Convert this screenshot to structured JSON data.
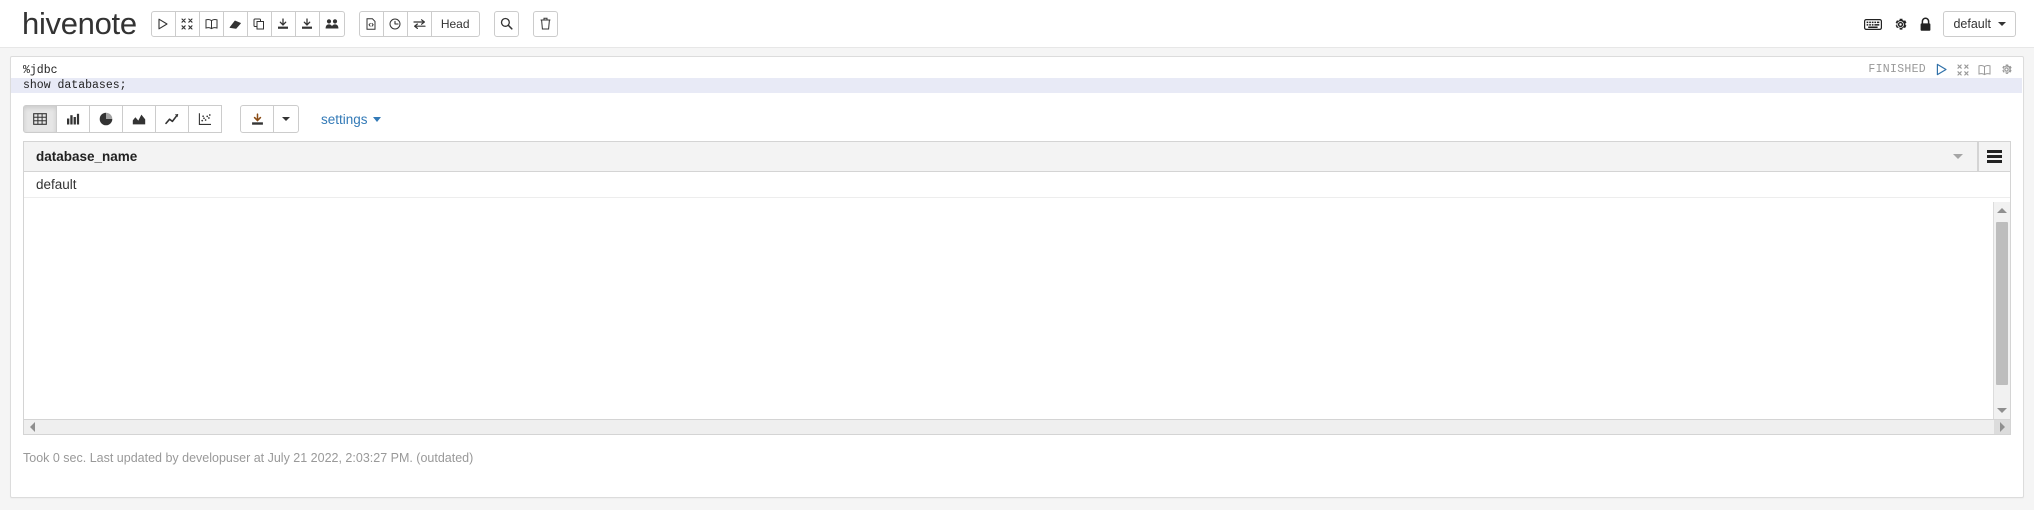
{
  "navbar": {
    "note_title": "hivenote",
    "left_tools": [
      {
        "name": "run-all-paragraphs-button",
        "icon": "play-icon",
        "title": "Run all paragraphs"
      },
      {
        "name": "hide-all-editors-button",
        "icon": "collapse-icon",
        "title": "Show/hide the code"
      },
      {
        "name": "hide-all-output-button",
        "icon": "book-icon",
        "title": "Show/hide the output"
      },
      {
        "name": "clear-all-output-button",
        "icon": "eraser-icon",
        "title": "Clear output"
      },
      {
        "name": "clone-note-button",
        "icon": "copy-icon",
        "title": "Clone this note"
      },
      {
        "name": "export-note-button",
        "icon": "download-icon",
        "title": "Export this note"
      },
      {
        "name": "import-note-button",
        "icon": "download-alt-icon",
        "title": "Import note"
      },
      {
        "name": "personalized-mode-button",
        "icon": "users-icon",
        "title": "Personalized mode"
      }
    ],
    "version_tools": [
      {
        "name": "commit-note-button",
        "icon": "file-code-icon",
        "title": "Commit"
      },
      {
        "name": "revision-button",
        "icon": "clock-icon",
        "title": "Revision"
      },
      {
        "name": "compare-revisions-button",
        "icon": "exchange-icon",
        "title": "Compare revisions"
      }
    ],
    "head_label": "Head",
    "search_button": {
      "name": "search-code-button",
      "icon": "search-icon"
    },
    "trash_button": {
      "name": "move-note-to-trash-button",
      "icon": "trash-icon"
    },
    "right_icons": [
      {
        "name": "keyboard-shortcuts-icon",
        "icon": "keyboard-icon"
      },
      {
        "name": "note-settings-icon",
        "icon": "gear-icon"
      },
      {
        "name": "note-permissions-icon",
        "icon": "lock-icon"
      }
    ],
    "interpreter_binding": "default"
  },
  "paragraph": {
    "code_lines": [
      "%jdbc",
      "show databases;"
    ],
    "active_line_index": 1,
    "status": "FINISHED",
    "status_icons": [
      {
        "name": "run-paragraph-icon",
        "icon": "play-icon"
      },
      {
        "name": "hide-editor-icon",
        "icon": "collapse-icon"
      },
      {
        "name": "hide-output-icon",
        "icon": "book-icon"
      },
      {
        "name": "paragraph-settings-icon",
        "icon": "gear-icon"
      }
    ],
    "footer": "Took 0 sec. Last updated by developuser at July 21 2022, 2:03:27 PM. (outdated)"
  },
  "viz": {
    "buttons": [
      {
        "name": "viz-table-button",
        "icon": "table-icon",
        "active": true
      },
      {
        "name": "viz-bar-chart-button",
        "icon": "bar-chart-icon",
        "active": false
      },
      {
        "name": "viz-pie-chart-button",
        "icon": "pie-chart-icon",
        "active": false
      },
      {
        "name": "viz-area-chart-button",
        "icon": "area-chart-icon",
        "active": false
      },
      {
        "name": "viz-line-chart-button",
        "icon": "line-chart-icon",
        "active": false
      },
      {
        "name": "viz-scatter-chart-button",
        "icon": "scatter-chart-icon",
        "active": false
      }
    ],
    "download_button": {
      "name": "download-data-button",
      "icon": "download-icon"
    },
    "download_caret": {
      "name": "download-format-dropdown",
      "icon": "caret-down-icon"
    },
    "settings_label": "settings"
  },
  "result_table": {
    "columns": [
      "database_name"
    ],
    "rows": [
      [
        "default"
      ]
    ],
    "sort_indicator": "chevron-down-icon",
    "menu_icon": "hamburger-menu-icon"
  },
  "colors": {
    "accent_blue": "#337ab7",
    "run_blue": "#3071a9",
    "active_line": "#e8eaf6",
    "status_grey": "#999999",
    "body_bg": "#f5f5f5"
  }
}
